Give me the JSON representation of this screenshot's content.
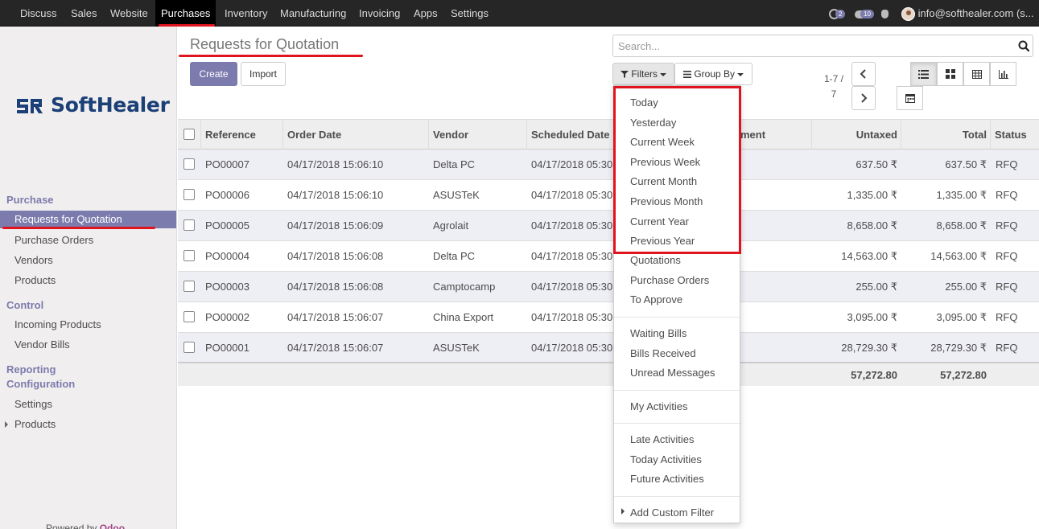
{
  "nav": {
    "apps": [
      "Discuss",
      "Sales",
      "Website",
      "Purchases",
      "Inventory",
      "Manufacturing",
      "Invoicing",
      "Apps",
      "Settings"
    ],
    "active_app": "Purchases",
    "activity_count": "2",
    "message_count": "10",
    "user": "info@softhealer.com (s..."
  },
  "sidebar": {
    "logo_text": "SoftHealer",
    "sections": [
      {
        "heading": "Purchase",
        "items": [
          "Requests for Quotation",
          "Purchase Orders",
          "Vendors",
          "Products"
        ]
      },
      {
        "heading": "Control",
        "items": [
          "Incoming Products",
          "Vendor Bills"
        ]
      },
      {
        "heading": "Reporting",
        "items": []
      },
      {
        "heading": "Configuration",
        "items": [
          "Settings",
          "Products"
        ]
      }
    ],
    "active_item": "Requests for Quotation",
    "powered_by": "Powered by",
    "powered_brand": "Odoo"
  },
  "control_panel": {
    "title": "Requests for Quotation",
    "create_label": "Create",
    "import_label": "Import",
    "search_placeholder": "Search...",
    "filters_label": "Filters",
    "groupby_label": "Group By",
    "pager_range": "1-7 /",
    "pager_total": "7"
  },
  "table": {
    "columns": [
      "Reference",
      "Order Date",
      "Vendor",
      "Scheduled Date",
      "ment",
      "Untaxed",
      "Total",
      "Status"
    ],
    "rows": [
      [
        "PO00007",
        "04/17/2018 15:06:10",
        "Delta PC",
        "04/17/2018 05:30",
        "637.50 ₹",
        "637.50 ₹",
        "RFQ"
      ],
      [
        "PO00006",
        "04/17/2018 15:06:10",
        "ASUSTeK",
        "04/17/2018 05:30",
        "1,335.00 ₹",
        "1,335.00 ₹",
        "RFQ"
      ],
      [
        "PO00005",
        "04/17/2018 15:06:09",
        "Agrolait",
        "04/17/2018 05:30",
        "8,658.00 ₹",
        "8,658.00 ₹",
        "RFQ"
      ],
      [
        "PO00004",
        "04/17/2018 15:06:08",
        "Delta PC",
        "04/17/2018 05:30",
        "14,563.00 ₹",
        "14,563.00 ₹",
        "RFQ"
      ],
      [
        "PO00003",
        "04/17/2018 15:06:08",
        "Camptocamp",
        "04/17/2018 05:30",
        "255.00 ₹",
        "255.00 ₹",
        "RFQ"
      ],
      [
        "PO00002",
        "04/17/2018 15:06:07",
        "China Export",
        "04/17/2018 05:30",
        "3,095.00 ₹",
        "3,095.00 ₹",
        "RFQ"
      ],
      [
        "PO00001",
        "04/17/2018 15:06:07",
        "ASUSTeK",
        "04/17/2018 05:30",
        "28,729.30 ₹",
        "28,729.30 ₹",
        "RFQ"
      ]
    ],
    "total_untaxed": "57,272.80",
    "total_total": "57,272.80"
  },
  "filters_menu": {
    "highlighted": [
      "Today",
      "Yesterday",
      "Current Week",
      "Previous Week",
      "Current Month",
      "Previous Month",
      "Current Year",
      "Previous Year"
    ],
    "group1": [
      "Quotations",
      "Purchase Orders",
      "To Approve"
    ],
    "group2": [
      "Waiting Bills",
      "Bills Received",
      "Unread Messages"
    ],
    "group3": [
      "My Activities"
    ],
    "group4": [
      "Late Activities",
      "Today Activities",
      "Future Activities"
    ],
    "custom": "Add Custom Filter"
  },
  "colors": {
    "accent": "#7c7bad",
    "highlight_red": "#e0141e",
    "navbar": "#262626"
  }
}
